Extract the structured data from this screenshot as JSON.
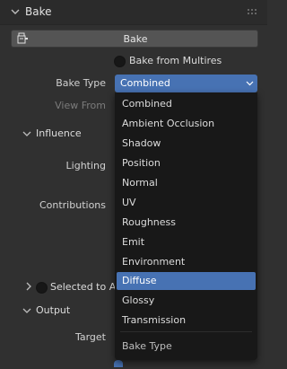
{
  "panel": {
    "title": "Bake",
    "collapsed": false
  },
  "bake_button": {
    "label": "Bake",
    "icon": "render-bake-icon"
  },
  "bake_from_multires": {
    "label": "Bake from Multires",
    "checked": false
  },
  "bake_type": {
    "label": "Bake Type",
    "value": "Combined"
  },
  "view_from": {
    "label": "View From"
  },
  "influence": {
    "title": "Influence",
    "lighting_label": "Lighting",
    "contributions_label": "Contributions"
  },
  "selected_to_active": {
    "title": "Selected to Acti",
    "checked": false
  },
  "output": {
    "title": "Output",
    "target_label": "Target"
  },
  "menu": {
    "title": "Bake Type",
    "items": [
      {
        "label": "Combined",
        "active": false
      },
      {
        "label": "Ambient Occlusion",
        "active": false
      },
      {
        "label": "Shadow",
        "active": false
      },
      {
        "label": "Position",
        "active": false
      },
      {
        "label": "Normal",
        "active": false
      },
      {
        "label": "UV",
        "active": false
      },
      {
        "label": "Roughness",
        "active": false
      },
      {
        "label": "Emit",
        "active": false
      },
      {
        "label": "Environment",
        "active": false
      },
      {
        "label": "Diffuse",
        "active": true
      },
      {
        "label": "Glossy",
        "active": false
      },
      {
        "label": "Transmission",
        "active": false
      }
    ]
  },
  "colors": {
    "accent": "#4772b3",
    "background": "#303030",
    "menu_background": "#181818"
  }
}
